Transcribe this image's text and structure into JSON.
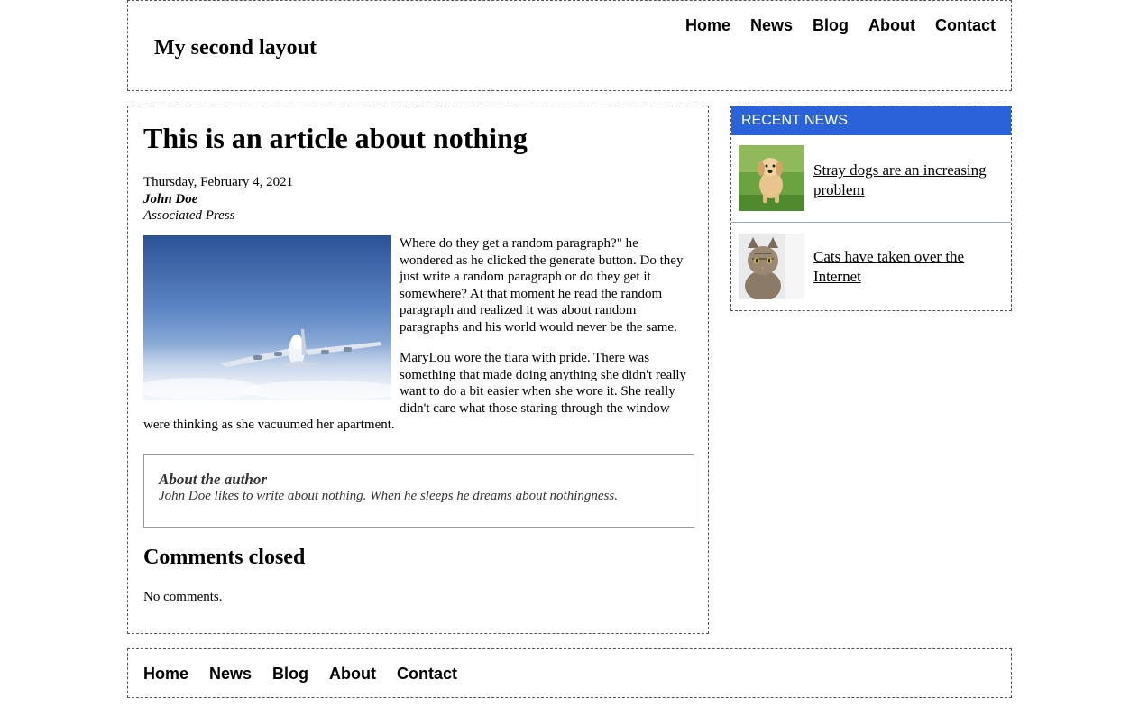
{
  "header": {
    "site_title": "My second layout",
    "nav": [
      "Home",
      "News",
      "Blog",
      "About",
      "Contact"
    ]
  },
  "article": {
    "title": "This is an article about nothing",
    "date": "Thursday, February 4, 2021",
    "author": "John Doe",
    "agency": "Associated Press",
    "paragraphs": [
      "Where do they get a random paragraph?\" he wondered as he clicked the generate button. Do they just write a random paragraph or do they get it somewhere? At that moment he read the random paragraph and realized it was about random paragraphs and his world would never be the same.",
      "MaryLou wore the tiara with pride. There was something that made doing anything she didn't really want to do a bit easier when she wore it. She really didn't care what those staring through the window were thinking as she vacuumed her apartment."
    ],
    "about_title": "About the author",
    "about_text": "John Doe likes to write about nothing. When he sleeps he dreams about nothingness.",
    "comments_title": "Comments closed",
    "comments_text": "No comments."
  },
  "sidebar": {
    "title": "RECENT NEWS",
    "items": [
      {
        "label": "Stray dogs are an increasing problem",
        "image": "puppy-photo"
      },
      {
        "label": "Cats have taken over the Internet",
        "image": "cat-photo"
      }
    ]
  },
  "footer": {
    "nav": [
      "Home",
      "News",
      "Blog",
      "About",
      "Contact"
    ]
  },
  "colors": {
    "sidebar_header": "#2a62d9",
    "border": "#555555"
  }
}
